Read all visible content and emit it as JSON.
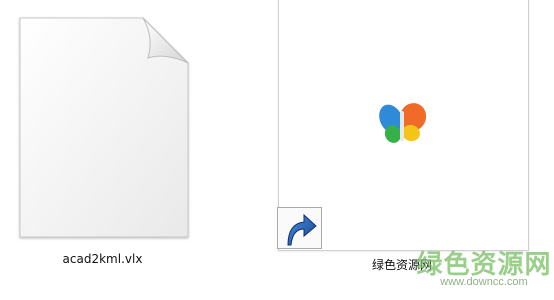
{
  "files": [
    {
      "name": "acad2kml.vlx",
      "icon": "blank-document-icon"
    },
    {
      "name": "绿色资源网",
      "icon": "msn-butterfly-icon",
      "overlay": "shortcut-arrow-icon"
    }
  ],
  "watermark": {
    "text": "绿色资源网",
    "url": "www.downcc.com"
  },
  "colors": {
    "background": "#ffffff",
    "shortcut_arrow": "#1f5fb3",
    "watermark_green": "#78be64"
  }
}
